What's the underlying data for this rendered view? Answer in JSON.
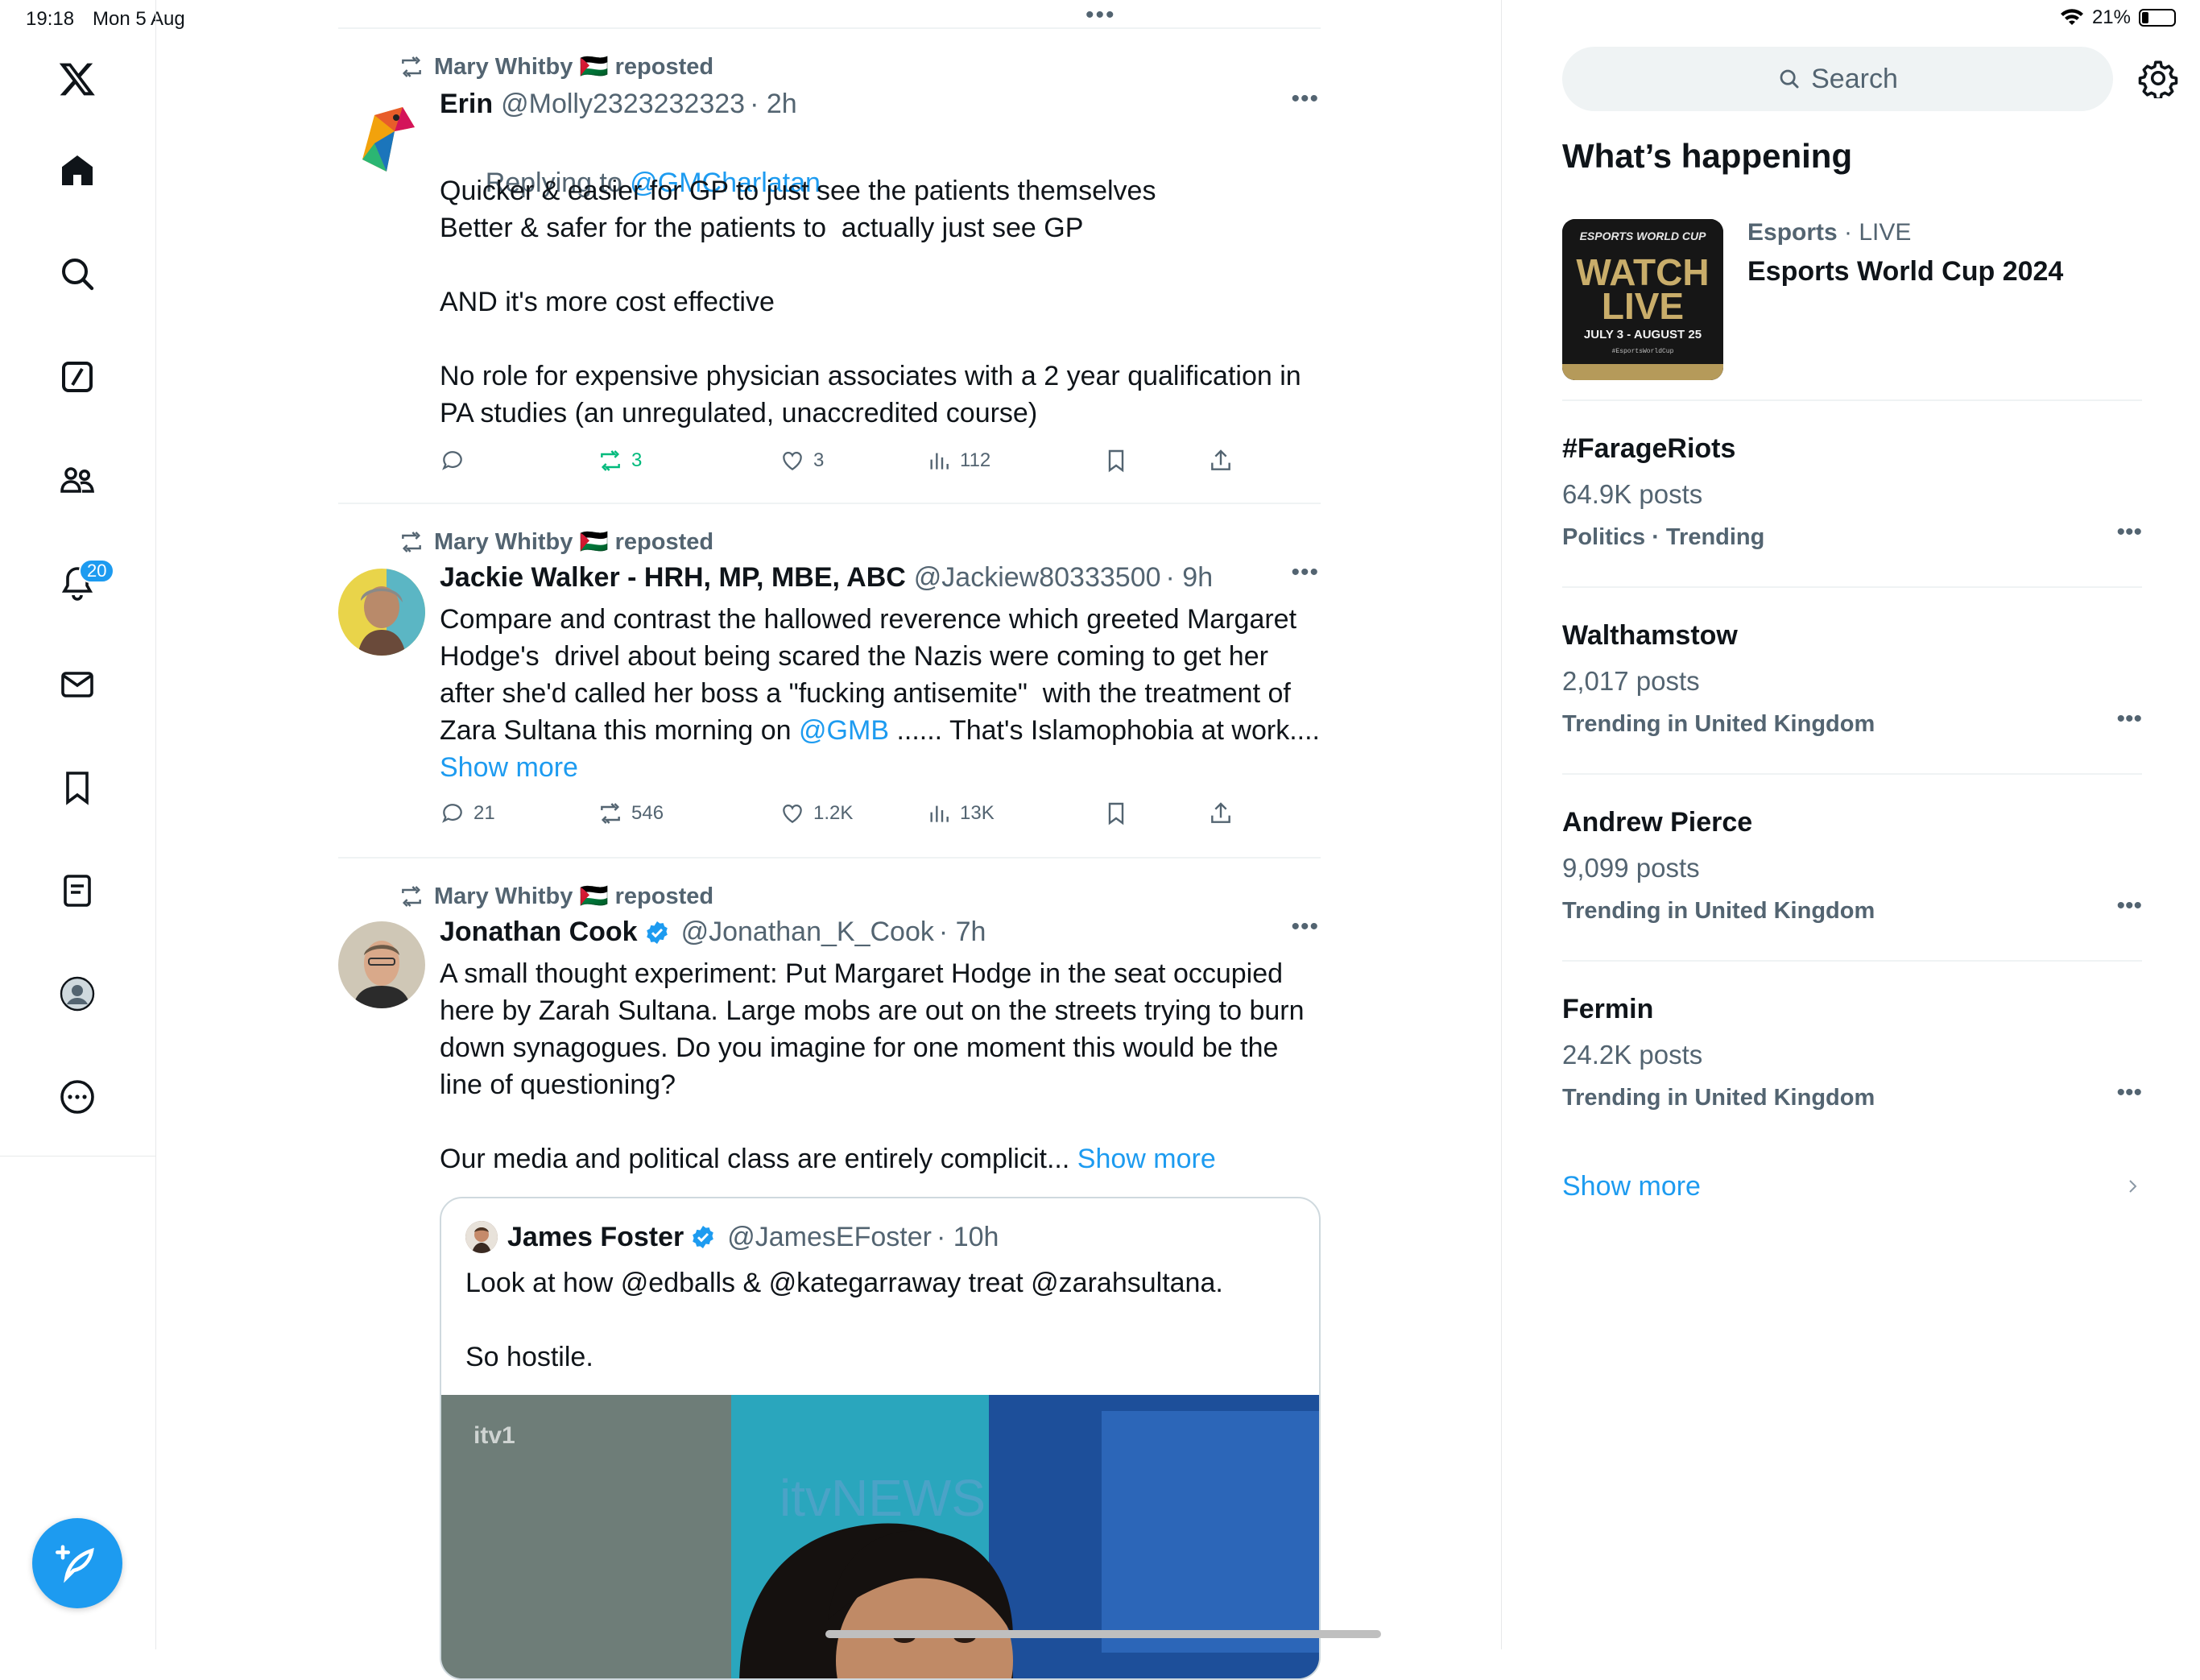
{
  "status": {
    "time": "19:18",
    "date": "Mon 5 Aug",
    "battery": "21%"
  },
  "nav": {
    "notif_count": "20"
  },
  "tweets": [
    {
      "reposted_by": "Mary Whitby 🇵🇸 reposted",
      "name": "Erin",
      "handle": "@Molly2323232323",
      "time": "· 2h",
      "replying_label": "Replying to ",
      "replying_to": "@GMCharlatan",
      "text": "Quicker & easier for GP to just see the patients themselves\nBetter & safer for the patients to  actually just see GP\n\nAND it's more cost effective\n\nNo role for expensive physician associates with a 2 year qualification in PA studies (an unregulated, unaccredited course)",
      "replies": "",
      "reposts": "3",
      "likes": "3",
      "views": "112"
    },
    {
      "reposted_by": "Mary Whitby 🇵🇸 reposted",
      "name": "Jackie Walker - HRH, MP, MBE, ABC",
      "handle": "@Jackiew80333500",
      "time": "· 9h",
      "text_a": "Compare and contrast the hallowed reverence which greeted Margaret Hodge's  drivel about being scared the Nazis were coming to get her after she'd called her boss a \"fucking antisemite\"  with the treatment of Zara Sultana this morning on ",
      "mention": "@GMB",
      "text_b": " ...... That's Islamophobia at work.... ",
      "show_more": "Show more",
      "replies": "21",
      "reposts": "546",
      "likes": "1.2K",
      "views": "13K"
    },
    {
      "reposted_by": "Mary Whitby 🇵🇸 reposted",
      "name": "Jonathan Cook",
      "handle": "@Jonathan_K_Cook",
      "time": "· 7h",
      "text": "A small thought experiment: Put Margaret Hodge in the seat occupied here by Zarah Sultana. Large mobs are out on the streets trying to burn down synagogues. Do you imagine for one moment this would be the line of questioning?\n\nOur media and political class are entirely complicit... ",
      "show_more": "Show more",
      "quote": {
        "name": "James Foster",
        "handle": "@JamesEFoster",
        "time": "· 10h",
        "text": "Look at how @edballs & @kategarraway treat @zarahsultana.\n\nSo hostile.",
        "image_channel": "itv1",
        "image_bg_text": "itvNEWS"
      }
    }
  ],
  "sidebar": {
    "search_placeholder": "Search",
    "title": "What’s happening",
    "event": {
      "category": "Esports",
      "status": "· LIVE",
      "title": "Esports World Cup 2024",
      "thumb_top": "ESPORTS WORLD CUP",
      "thumb_main_1": "WATCH",
      "thumb_main_2": "LIVE",
      "thumb_dates": "JULY 3 - AUGUST 25",
      "thumb_tag": "#EsportsWorldCup"
    },
    "trends": [
      {
        "name": "#FarageRiots",
        "posts": "64.9K posts",
        "context": "Politics · Trending"
      },
      {
        "name": "Walthamstow",
        "posts": "2,017 posts",
        "context": "Trending in United Kingdom"
      },
      {
        "name": "Andrew Pierce",
        "posts": "9,099 posts",
        "context": "Trending in United Kingdom"
      },
      {
        "name": "Fermin",
        "posts": "24.2K posts",
        "context": "Trending in United Kingdom"
      }
    ],
    "show_more": "Show more"
  },
  "colors": {
    "accent": "#1d9bf0",
    "repost_green": "#00ba7c",
    "muted": "#536471"
  }
}
